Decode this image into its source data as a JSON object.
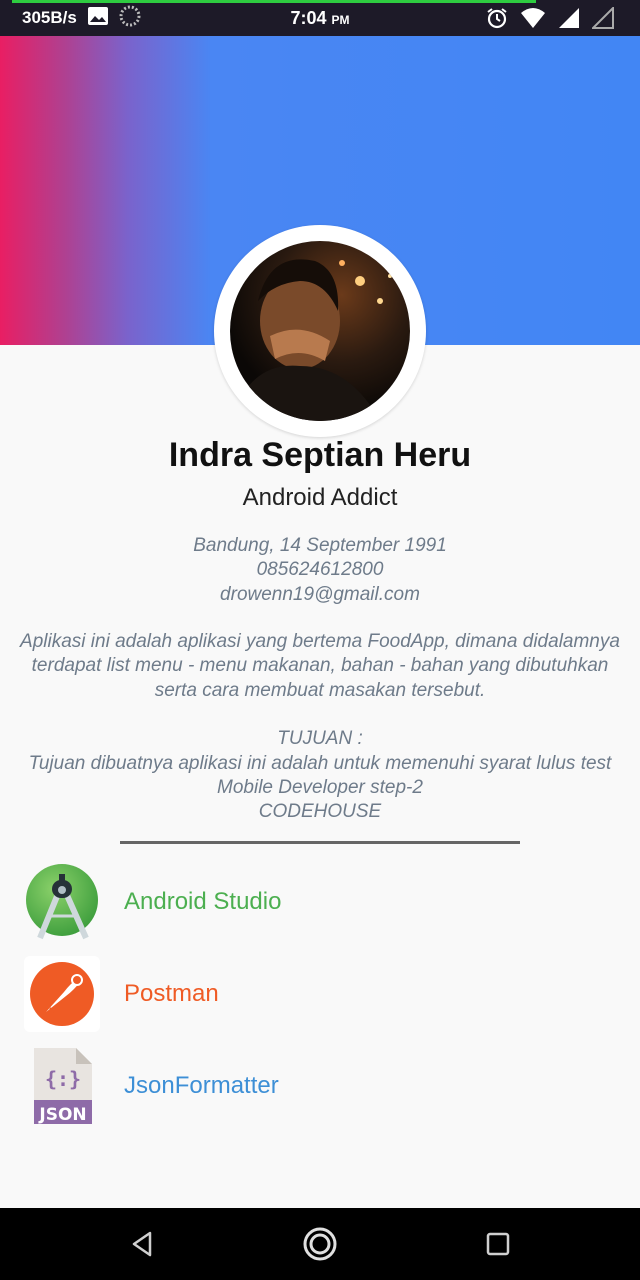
{
  "status_bar": {
    "net_speed": "305B/s",
    "time": "7:04",
    "ampm": "PM"
  },
  "profile": {
    "name": "Indra Septian Heru",
    "role": "Android Addict",
    "birth": "Bandung, 14 September 1991",
    "phone": "085624612800",
    "email": "drowenn19@gmail.com"
  },
  "description": {
    "text": "Aplikasi ini adalah aplikasi yang bertema FoodApp, dimana didalamnya terdapat list menu - menu makanan, bahan - bahan yang dibutuhkan serta cara membuat masakan tersebut.",
    "goal_title": "TUJUAN :",
    "goal_text": "Tujuan dibuatnya aplikasi ini adalah untuk memenuhi syarat lulus test Mobile Developer step-2",
    "org": "CODEHOUSE"
  },
  "tools": [
    {
      "label": "Android Studio",
      "color": "#4caf50",
      "icon": "android-studio-icon"
    },
    {
      "label": "Postman",
      "color": "#ef5b25",
      "icon": "postman-icon"
    },
    {
      "label": "JsonFormatter",
      "color": "#3d8fd6",
      "icon": "json-file-icon"
    }
  ],
  "json_icon_label": "JSON",
  "json_icon_glyph": "{:}",
  "colors": {
    "header_gradient_start": "#e91e63",
    "header_gradient_end": "#4286f4",
    "text_muted": "#6e7b8a"
  }
}
